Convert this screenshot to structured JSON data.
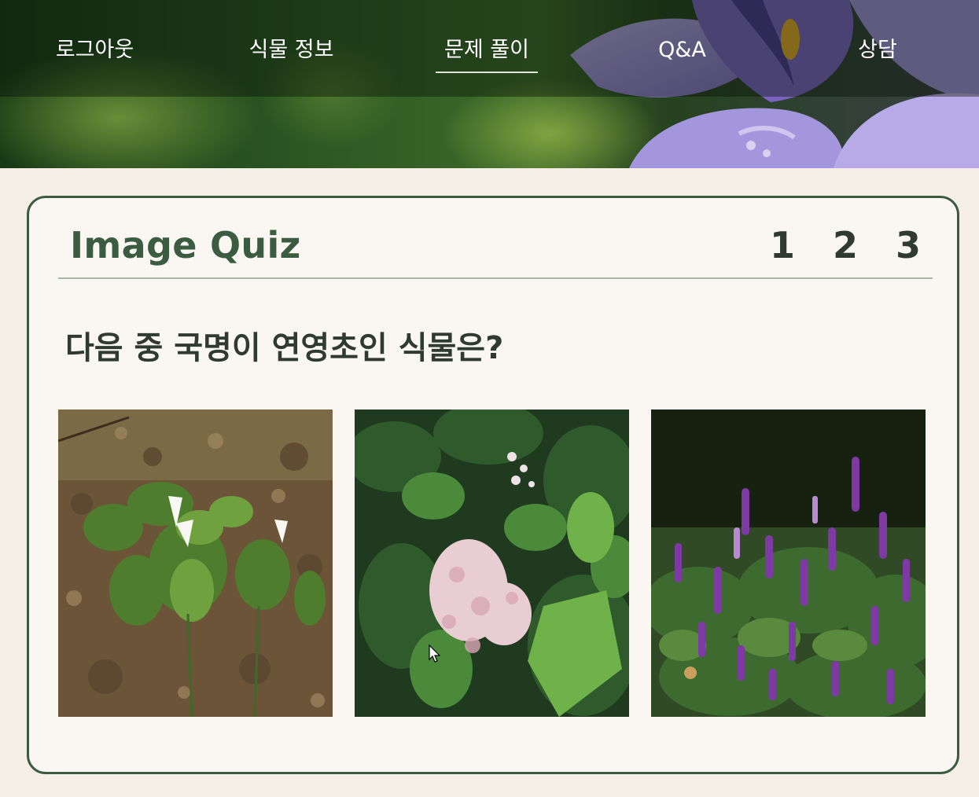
{
  "nav": {
    "items": [
      {
        "label": "로그아웃"
      },
      {
        "label": "식물 정보"
      },
      {
        "label": "문제 풀이",
        "active": true
      },
      {
        "label": "Q&A"
      },
      {
        "label": "상담"
      }
    ]
  },
  "quiz": {
    "title": "Image Quiz",
    "pages": [
      "1",
      "2",
      "3"
    ],
    "question": "다음 중 국명이 연영초인 식물은?"
  },
  "colors": {
    "accent": "#3c5c41",
    "text_dark": "#2f3b31",
    "page_bg": "#f6efe8",
    "card_bg": "#faf6f2"
  }
}
